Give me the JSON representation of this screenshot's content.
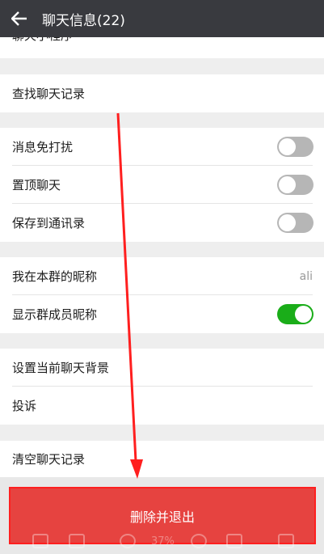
{
  "header": {
    "title": "聊天信息(22)"
  },
  "rows": {
    "mini_programs": "聊天小程序",
    "search_history": "查找聊天记录",
    "mute": "消息免打扰",
    "pin": "置顶聊天",
    "save_contacts": "保存到通讯录",
    "my_nickname": "我在本群的昵称",
    "my_nickname_value": "ali",
    "show_nicknames": "显示群成员昵称",
    "set_background": "设置当前聊天背景",
    "complain": "投诉",
    "clear_history": "清空聊天记录"
  },
  "toggles": {
    "mute": false,
    "pin": false,
    "save_contacts": false,
    "show_nicknames": true
  },
  "delete_button": "删除并退出",
  "viewer": {
    "zoom": "37%"
  },
  "colors": {
    "header_bg": "#393a3f",
    "toggle_on": "#1aad19",
    "toggle_off": "#b6b6b6",
    "delete_bg": "#e64340",
    "annotation": "#ff1f1f"
  }
}
